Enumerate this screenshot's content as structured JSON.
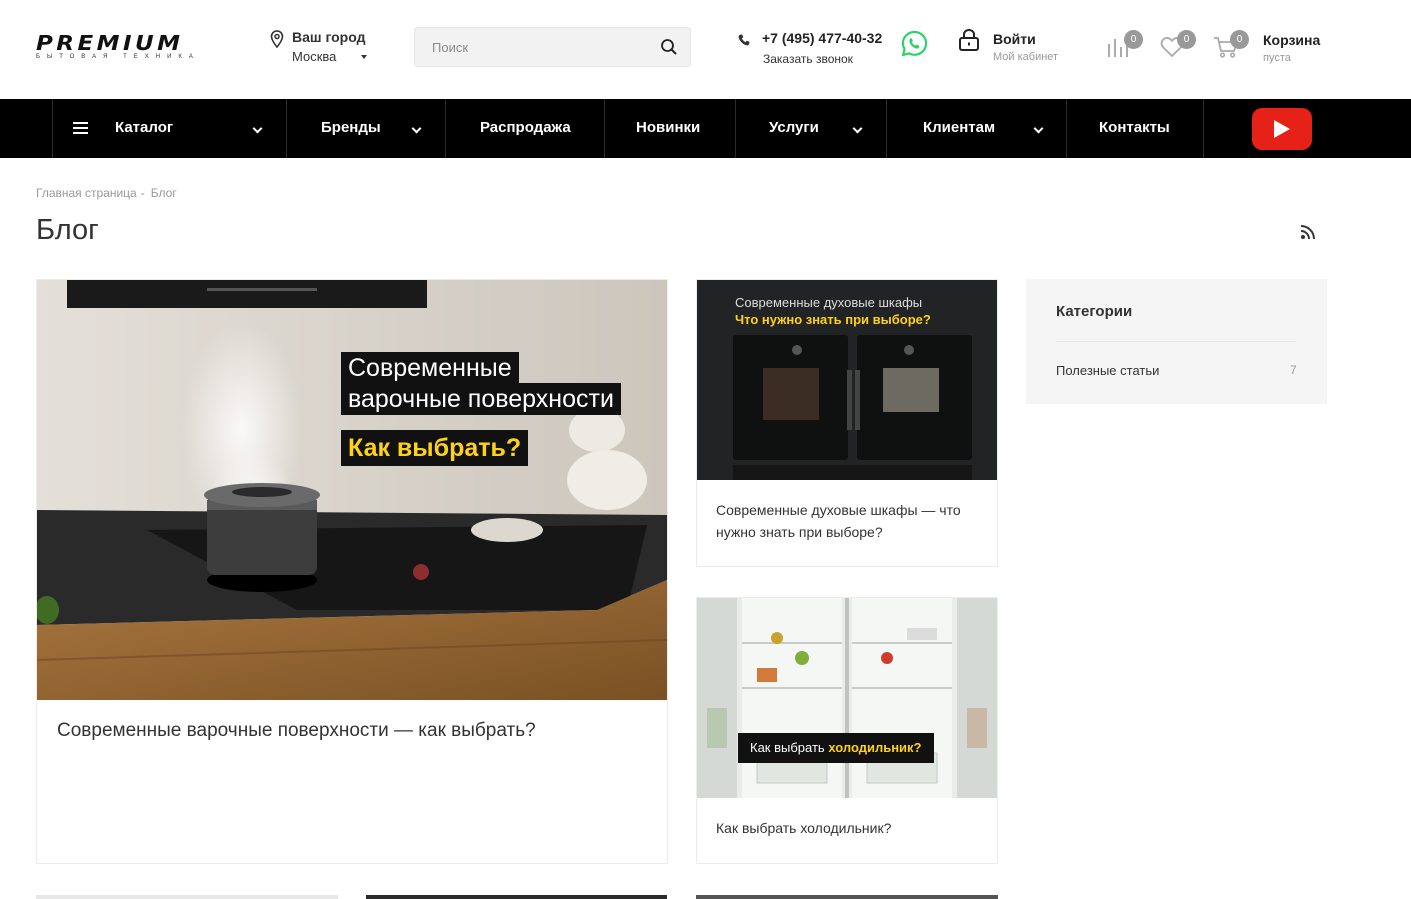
{
  "header": {
    "logo": {
      "word": "PREMIUM",
      "sub": "БЫТОВАЯ ТЕХНИКА"
    },
    "city": {
      "label": "Ваш город",
      "value": "Москва"
    },
    "search": {
      "placeholder": "Поиск"
    },
    "phone": {
      "number": "+7 (495) 477-40-32",
      "callback": "Заказать звонок"
    },
    "login": {
      "title": "Войти",
      "subtitle": "Мой кабинет"
    },
    "compare": {
      "icon": "compare-icon",
      "count": "0"
    },
    "favorites": {
      "icon": "heart-icon",
      "count": "0"
    },
    "cart": {
      "icon": "cart-icon",
      "count": "0",
      "title": "Корзина",
      "status": "пуста"
    }
  },
  "nav": {
    "items": [
      {
        "label": "Каталог",
        "dropdown": true
      },
      {
        "label": "Бренды",
        "dropdown": true
      },
      {
        "label": "Распродажа",
        "dropdown": false
      },
      {
        "label": "Новинки",
        "dropdown": false
      },
      {
        "label": "Услуги",
        "dropdown": true
      },
      {
        "label": "Клиентам",
        "dropdown": true
      },
      {
        "label": "Контакты",
        "dropdown": false
      }
    ],
    "youtube_icon": "youtube-icon"
  },
  "breadcrumbs": [
    "Главная страница",
    "Блог"
  ],
  "page": {
    "title": "Блог"
  },
  "posts": [
    {
      "title": "Современные варочные поверхности — как выбрать?",
      "overlay_lines": [
        "Современные",
        "варочные поверхности"
      ],
      "overlay_accent": "Как выбрать?"
    },
    {
      "title": "Современные духовые шкафы — что нужно знать при выборе?",
      "overlay_line": "Современные духовые шкафы",
      "overlay_accent": "Что нужно знать при выборе?"
    },
    {
      "title": "Как выбрать холодильник?",
      "overlay_text": "Как выбрать",
      "overlay_accent": "холодильник?"
    }
  ],
  "sidebar": {
    "heading": "Категории",
    "categories": [
      {
        "name": "Полезные статьи",
        "count": "7"
      }
    ]
  },
  "colors": {
    "nav_bg": "#000000",
    "accent_yellow": "#ffd21a",
    "youtube_red": "#e62117",
    "whatsapp_green": "#25d366"
  }
}
